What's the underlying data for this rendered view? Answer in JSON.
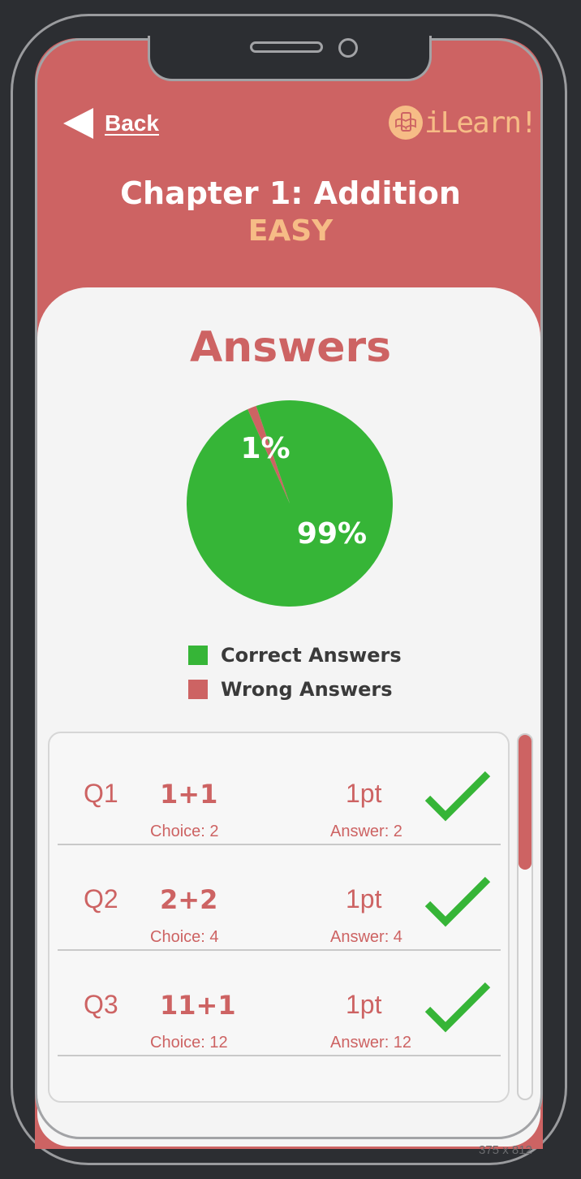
{
  "header": {
    "back_label": "Back",
    "logo_text": "iLearn!",
    "chapter_title": "Chapter 1: Addition",
    "difficulty": "EASY"
  },
  "results": {
    "title": "Answers"
  },
  "chart_data": {
    "type": "pie",
    "slices": [
      {
        "name": "Correct Answers",
        "value": 99,
        "label": "99%",
        "color": "#36b537"
      },
      {
        "name": "Wrong Answers",
        "value": 1,
        "label": "1%",
        "color": "#cd6363"
      }
    ],
    "legend": [
      "Correct Answers",
      "Wrong Answers"
    ],
    "legend_placement": "bottom"
  },
  "questions": [
    {
      "number": "Q1",
      "expression": "1+1",
      "choice": "Choice: 2",
      "points": "1pt",
      "answer": "Answer: 2",
      "status_icon": "check-icon"
    },
    {
      "number": "Q2",
      "expression": "2+2",
      "choice": "Choice: 4",
      "points": "1pt",
      "answer": "Answer: 4",
      "status_icon": "check-icon"
    },
    {
      "number": "Q3",
      "expression": "11+1",
      "choice": "Choice: 12",
      "points": "1pt",
      "answer": "Answer: 12",
      "status_icon": "check-icon"
    }
  ],
  "device_dimensions": "375 x 812",
  "colors": {
    "brand": "#cd6363",
    "accent": "#f6bc86",
    "correct": "#36b537"
  }
}
